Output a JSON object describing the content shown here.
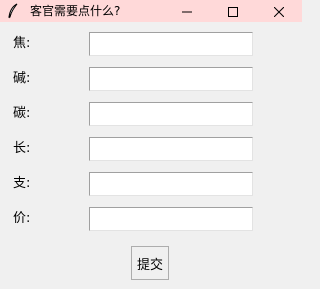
{
  "window": {
    "title": "客官需要点什么?",
    "icon": "feather-icon"
  },
  "titlebar_controls": [
    "minimize-icon",
    "maximize-icon",
    "close-icon"
  ],
  "form": {
    "fields": [
      {
        "label": "焦:",
        "value": ""
      },
      {
        "label": "碱:",
        "value": ""
      },
      {
        "label": "碳:",
        "value": ""
      },
      {
        "label": "长:",
        "value": ""
      },
      {
        "label": "支:",
        "value": ""
      },
      {
        "label": "价:",
        "value": ""
      }
    ],
    "submit_label": "提交"
  }
}
